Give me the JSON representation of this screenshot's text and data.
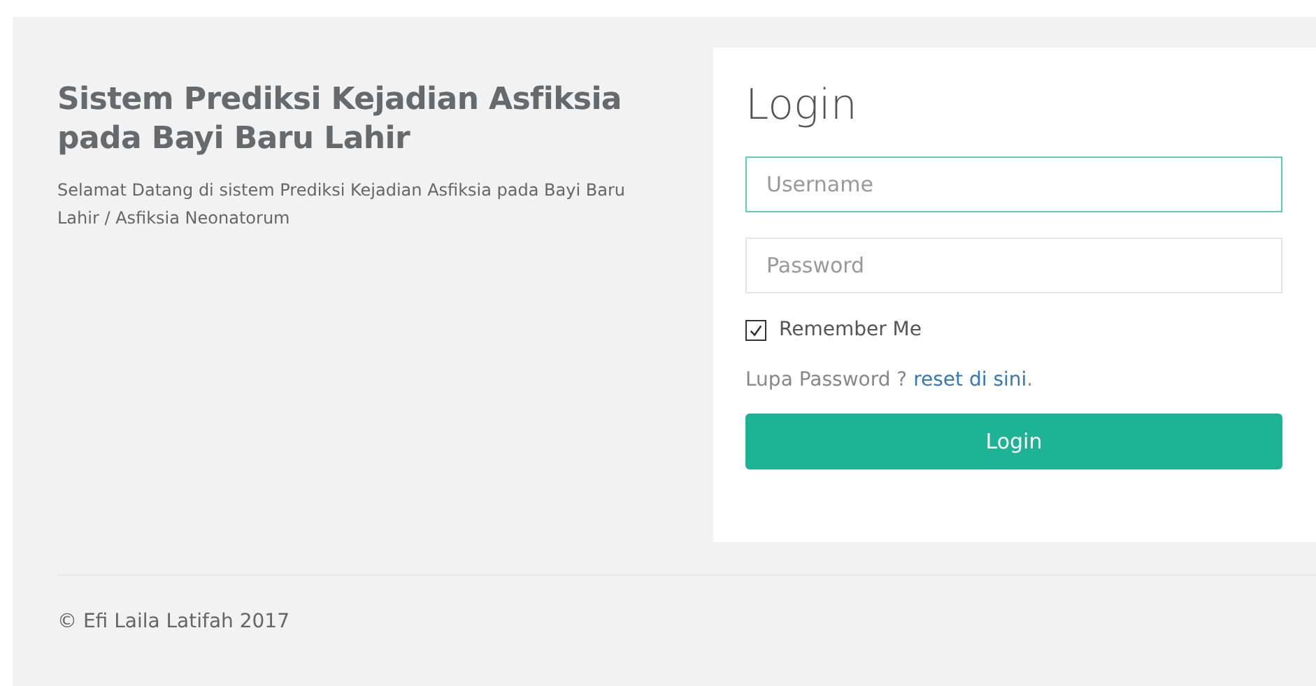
{
  "intro": {
    "title": "Sistem Prediksi Kejadian Asfiksia pada Bayi Baru Lahir",
    "text": "Selamat Datang di sistem Prediksi Kejadian Asfiksia pada Bayi Baru Lahir / Asfiksia Neonatorum"
  },
  "login": {
    "title": "Login",
    "fields": [
      {
        "placeholder": "Username",
        "focused": true
      },
      {
        "placeholder": "Password",
        "focused": false
      }
    ],
    "remember": {
      "label": "Remember Me",
      "checked": true
    },
    "forgot": {
      "text": "Lupa Password ?",
      "link": "reset di sini",
      "after": "."
    },
    "button": "Login"
  },
  "footer": "© Efi Laila Latifah 2017"
}
